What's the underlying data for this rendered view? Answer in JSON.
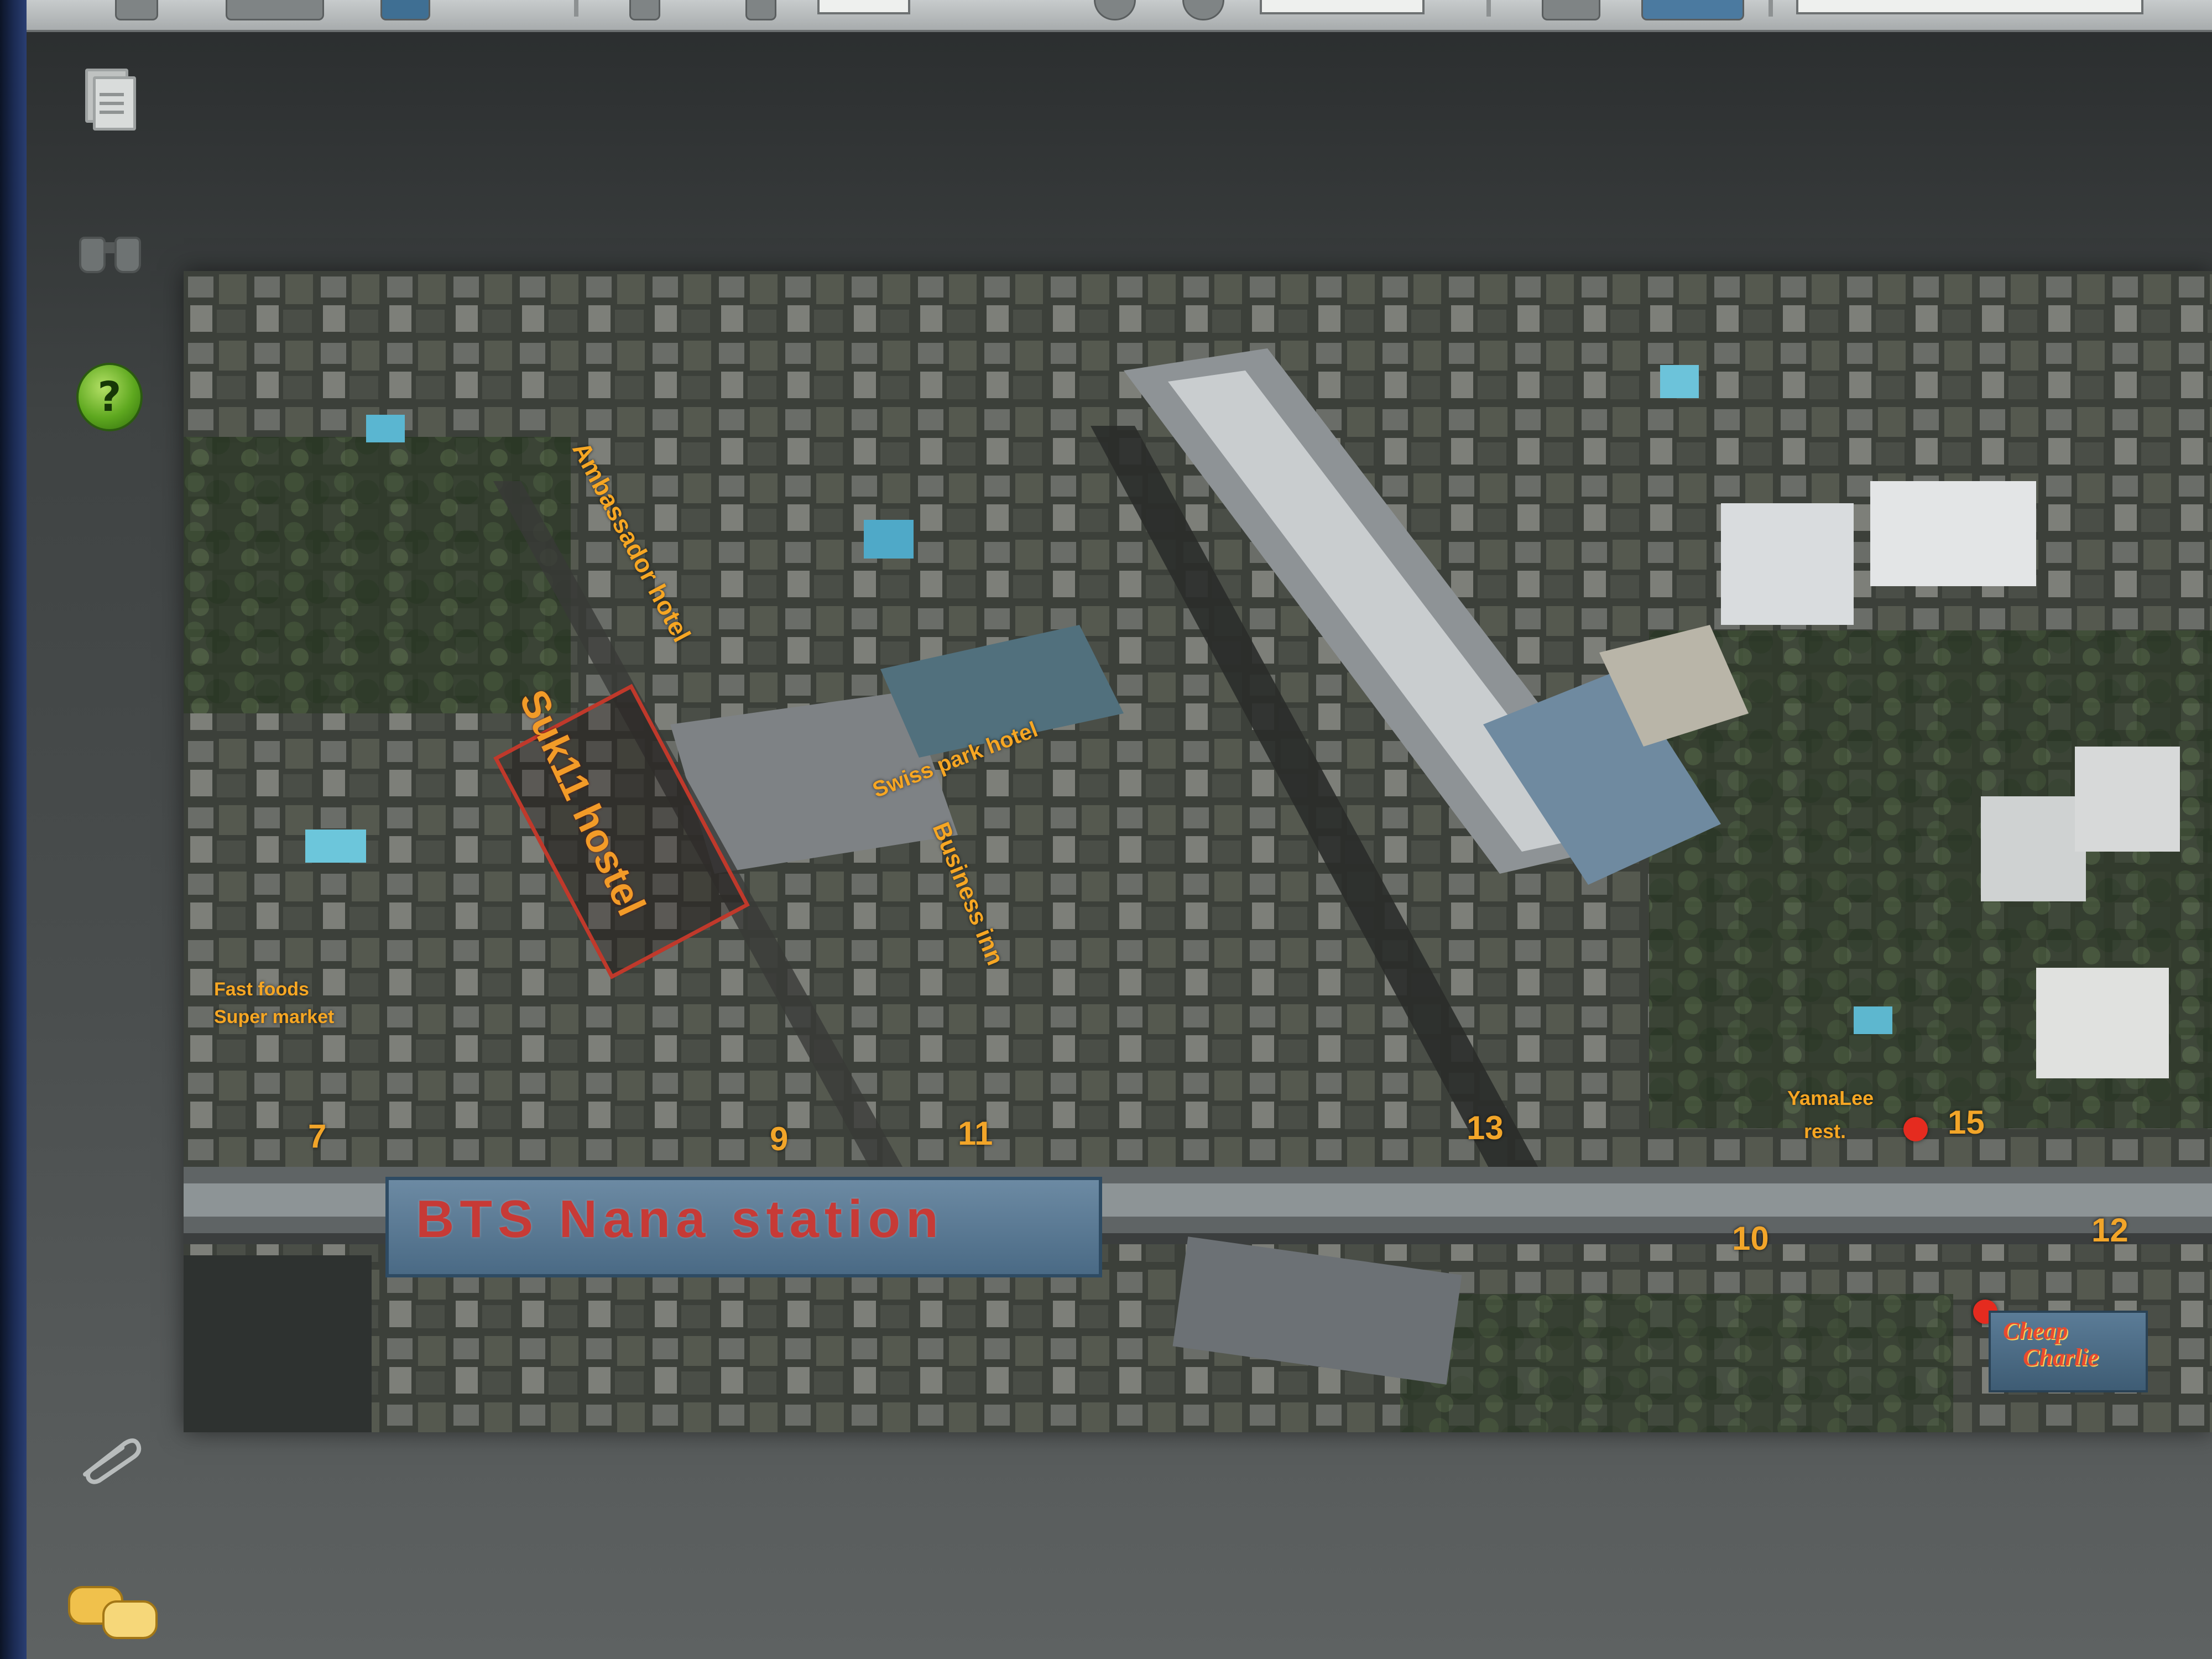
{
  "map": {
    "labels": {
      "ambassador": "Ambassador hotel",
      "suk11": "Suk11 hostel",
      "swiss_park": "Swiss park hotel",
      "business_inn": "Business inn",
      "fast_foods": "Fast foods",
      "super_market": "Super market",
      "yamalee_name": "YamaLee",
      "yamalee_rest": "rest.",
      "station": "BTS Nana station",
      "logo_line1": "Cheap",
      "logo_line2": "Charlie"
    },
    "sois": [
      "7",
      "9",
      "11",
      "13",
      "15",
      "10",
      "12"
    ]
  },
  "colors": {
    "label": "#f6a623",
    "marker": "#e52b1f",
    "station": "#c73a36"
  },
  "icons": {
    "sidebar": [
      "document-icon",
      "binoculars-icon",
      "help-icon",
      "paperclip-icon",
      "comments-icon"
    ]
  },
  "help_glyph": "?"
}
